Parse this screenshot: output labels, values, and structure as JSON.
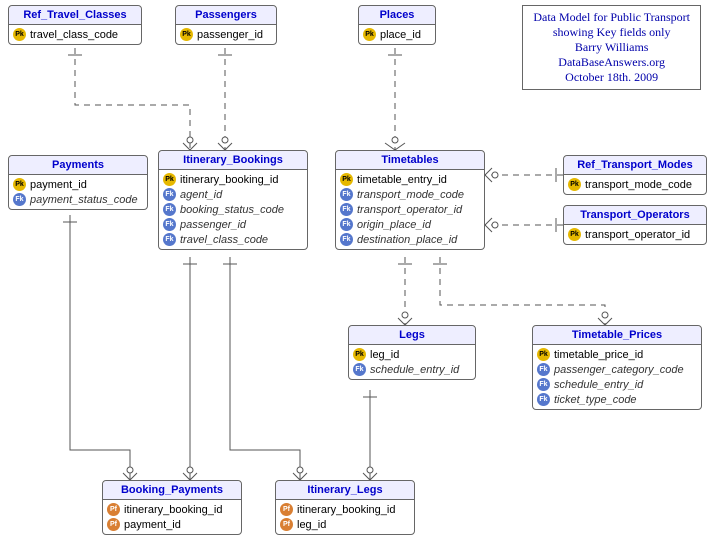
{
  "caption": {
    "line1": "Data Model for Public Transport",
    "line2": "showing Key fields only",
    "line3": "Barry Williams",
    "line4": "DataBaseAnswers.org",
    "line5": "October 18th. 2009"
  },
  "entities": {
    "ref_travel_classes": {
      "title": "Ref_Travel_Classes",
      "fields": [
        {
          "key": "PK",
          "name": "travel_class_code",
          "fk": false
        }
      ]
    },
    "passengers": {
      "title": "Passengers",
      "fields": [
        {
          "key": "PK",
          "name": "passenger_id",
          "fk": false
        }
      ]
    },
    "places": {
      "title": "Places",
      "fields": [
        {
          "key": "PK",
          "name": "place_id",
          "fk": false
        }
      ]
    },
    "payments": {
      "title": "Payments",
      "fields": [
        {
          "key": "PK",
          "name": "payment_id",
          "fk": false
        },
        {
          "key": "FK",
          "name": "payment_status_code",
          "fk": true
        }
      ]
    },
    "itinerary_bookings": {
      "title": "Itinerary_Bookings",
      "fields": [
        {
          "key": "PK",
          "name": "itinerary_booking_id",
          "fk": false
        },
        {
          "key": "FK",
          "name": "agent_id",
          "fk": true
        },
        {
          "key": "FK",
          "name": "booking_status_code",
          "fk": true
        },
        {
          "key": "FK",
          "name": "passenger_id",
          "fk": true
        },
        {
          "key": "FK",
          "name": "travel_class_code",
          "fk": true
        }
      ]
    },
    "timetables": {
      "title": "Timetables",
      "fields": [
        {
          "key": "PK",
          "name": "timetable_entry_id",
          "fk": false
        },
        {
          "key": "FK",
          "name": "transport_mode_code",
          "fk": true
        },
        {
          "key": "FK",
          "name": "transport_operator_id",
          "fk": true
        },
        {
          "key": "FK",
          "name": "origin_place_id",
          "fk": true
        },
        {
          "key": "FK",
          "name": "destination_place_id",
          "fk": true
        }
      ]
    },
    "ref_transport_modes": {
      "title": "Ref_Transport_Modes",
      "fields": [
        {
          "key": "PK",
          "name": "transport_mode_code",
          "fk": false
        }
      ]
    },
    "transport_operators": {
      "title": "Transport_Operators",
      "fields": [
        {
          "key": "PK",
          "name": "transport_operator_id",
          "fk": false
        }
      ]
    },
    "legs": {
      "title": "Legs",
      "fields": [
        {
          "key": "PK",
          "name": "leg_id",
          "fk": false
        },
        {
          "key": "FK",
          "name": "schedule_entry_id",
          "fk": true
        }
      ]
    },
    "timetable_prices": {
      "title": "Timetable_Prices",
      "fields": [
        {
          "key": "PK",
          "name": "timetable_price_id",
          "fk": false
        },
        {
          "key": "FK",
          "name": "passenger_category_code",
          "fk": true
        },
        {
          "key": "FK",
          "name": "schedule_entry_id",
          "fk": true
        },
        {
          "key": "FK",
          "name": "ticket_type_code",
          "fk": true
        }
      ]
    },
    "booking_payments": {
      "title": "Booking_Payments",
      "fields": [
        {
          "key": "PF",
          "name": "itinerary_booking_id",
          "fk": false
        },
        {
          "key": "PF",
          "name": "payment_id",
          "fk": false
        }
      ]
    },
    "itinerary_legs": {
      "title": "Itinerary_Legs",
      "fields": [
        {
          "key": "PF",
          "name": "itinerary_booking_id",
          "fk": false
        },
        {
          "key": "PF",
          "name": "leg_id",
          "fk": false
        }
      ]
    }
  }
}
